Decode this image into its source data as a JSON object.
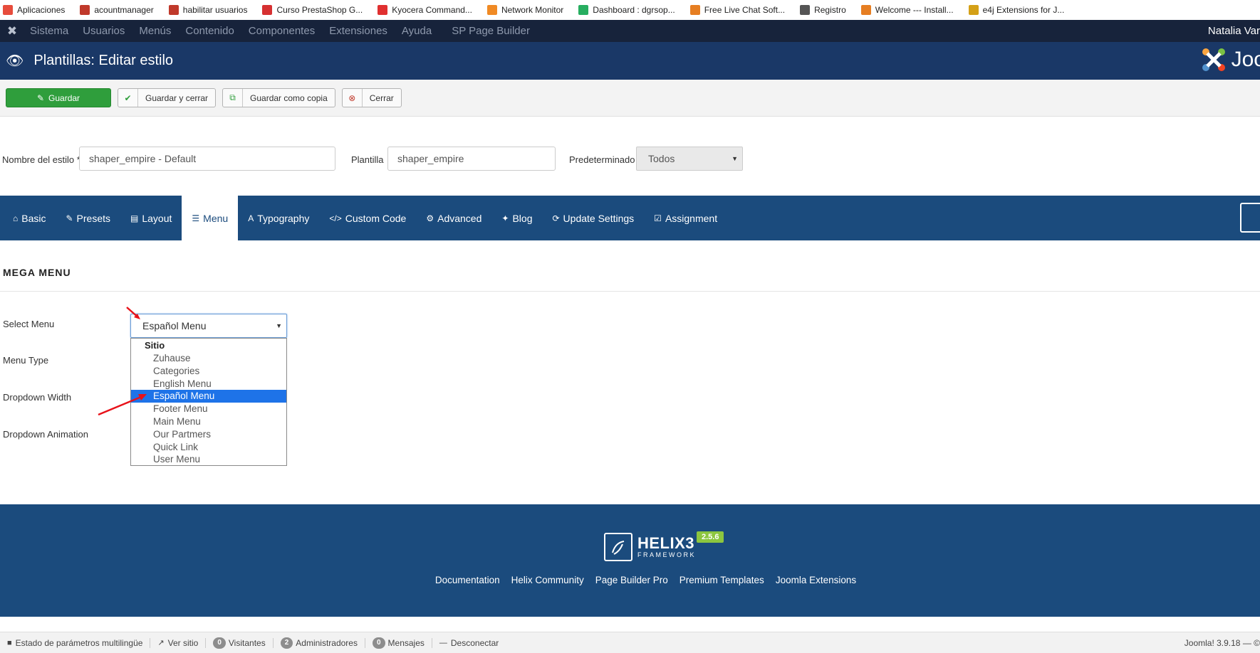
{
  "bookmarks": [
    {
      "label": "Aplicaciones",
      "icon": "apps-grid-icon",
      "color": "#e74c3c"
    },
    {
      "label": "acountmanager",
      "icon": "dgr-favicon",
      "color": "#c0392b"
    },
    {
      "label": "habilitar usuarios",
      "icon": "dgr-favicon",
      "color": "#c0392b"
    },
    {
      "label": "Curso PrestaShop G...",
      "icon": "prestashop-favicon",
      "color": "#d63031"
    },
    {
      "label": "Kyocera Command...",
      "icon": "kyocera-favicon",
      "color": "#e03030"
    },
    {
      "label": "Network Monitor",
      "icon": "network-monitor-favicon",
      "color": "#f08a24"
    },
    {
      "label": "Dashboard : dgrsop...",
      "icon": "dashboard-favicon",
      "color": "#27ae60"
    },
    {
      "label": "Free Live Chat Soft...",
      "icon": "livechat-favicon",
      "color": "#e67e22"
    },
    {
      "label": "Registro",
      "icon": "registro-favicon",
      "color": "#555555"
    },
    {
      "label": "Welcome --- Install...",
      "icon": "welcome-favicon",
      "color": "#e67e22"
    },
    {
      "label": "e4j Extensions for J...",
      "icon": "e4j-favicon",
      "color": "#d4a017"
    }
  ],
  "admin_menu": {
    "items": [
      "Sistema",
      "Usuarios",
      "Menús",
      "Contenido",
      "Componentes",
      "Extensiones",
      "Ayuda"
    ],
    "extra": "SP Page Builder",
    "user": "Natalia Var"
  },
  "header": {
    "title": "Plantillas: Editar estilo",
    "brand_text": "Joo"
  },
  "toolbar": {
    "save": "Guardar",
    "save_close": "Guardar y cerrar",
    "save_copy": "Guardar como copia",
    "close": "Cerrar"
  },
  "form": {
    "style_name_label": "Nombre del estilo *",
    "style_name_value": "shaper_empire - Default",
    "template_label": "Plantilla",
    "template_value": "shaper_empire",
    "default_label": "Predeterminado",
    "default_value": "Todos"
  },
  "tabs": [
    {
      "label": "Basic",
      "glyph": "⌂"
    },
    {
      "label": "Presets",
      "glyph": "✎"
    },
    {
      "label": "Layout",
      "glyph": "▤"
    },
    {
      "label": "Menu",
      "glyph": "☰"
    },
    {
      "label": "Typography",
      "glyph": "A"
    },
    {
      "label": "Custom Code",
      "glyph": "</>"
    },
    {
      "label": "Advanced",
      "glyph": "⚙"
    },
    {
      "label": "Blog",
      "glyph": "✦"
    },
    {
      "label": "Update Settings",
      "glyph": "⟳"
    },
    {
      "label": "Assignment",
      "glyph": "☑"
    }
  ],
  "active_tab": "Menu",
  "mega_menu": {
    "title": "MEGA MENU",
    "labels": {
      "select_menu": "Select Menu",
      "menu_type": "Menu Type",
      "dropdown_width": "Dropdown Width",
      "dropdown_animation": "Dropdown Animation"
    },
    "selected_value": "Español Menu",
    "group_label": "Sitio",
    "options": [
      "Zuhause",
      "Categories",
      "English Menu",
      "Español Menu",
      "Footer Menu",
      "Main Menu",
      "Our Partmers",
      "Quick Link",
      "User Menu"
    ]
  },
  "footer": {
    "logo_main": "HELIX3",
    "logo_sub": "FRAMEWORK",
    "version": "2.5.6",
    "links": [
      "Documentation",
      "Helix Community",
      "Page Builder Pro",
      "Premium Templates",
      "Joomla Extensions"
    ]
  },
  "status_bar": {
    "multilang": "Estado de parámetros multilingüe",
    "view_site": "Ver sitio",
    "visitors_count": "0",
    "visitors": "Visitantes",
    "admins_count": "2",
    "admins": "Administradores",
    "messages_count": "0",
    "messages": "Mensajes",
    "logout": "Desconectar",
    "version": "Joomla! 3.9.18 — ©"
  },
  "colors": {
    "admin_bar": "#17233b",
    "header": "#1a3867",
    "tabs": "#1b4b7d",
    "primary_button": "#2f9e3c",
    "selected_option": "#1e73e8",
    "annotation_arrow": "#e8121a"
  }
}
